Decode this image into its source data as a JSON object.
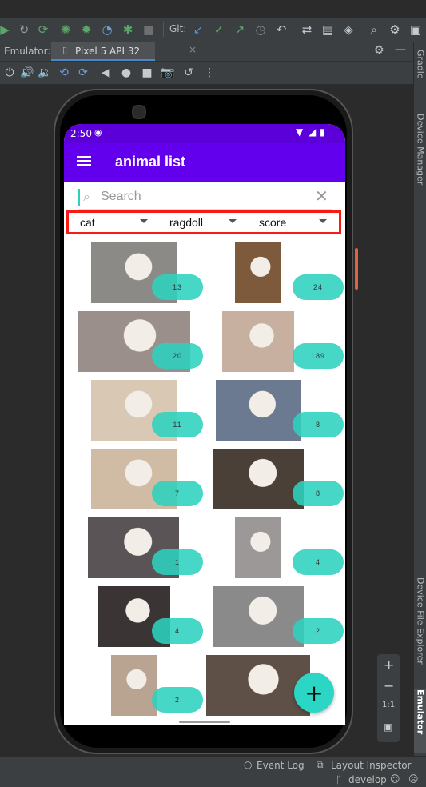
{
  "ide": {
    "git_label": "Git:",
    "tabs": {
      "emulator_label": "Emulator:",
      "device_tab": "Pixel 5 API 32",
      "close_glyph": "×"
    },
    "side_tools": {
      "gradle": "Gradle",
      "device_manager": "Device Manager",
      "device_file_explorer": "Device File Explorer",
      "emulator": "Emulator"
    },
    "zoom": {
      "plus": "+",
      "minus": "−",
      "ratio": "1:1"
    },
    "status": {
      "event_log": "Event Log",
      "layout_inspector": "Layout Inspector",
      "branch": "develop"
    }
  },
  "device": {
    "time": "2:50",
    "app_title": "animal list",
    "search_placeholder": "Search",
    "filters": {
      "animal": "cat",
      "breed": "ragdoll",
      "sort": "score"
    },
    "animals": [
      {
        "score": "13",
        "color": "#8c8a86"
      },
      {
        "score": "24",
        "color": "#7d5a3c"
      },
      {
        "score": "20",
        "color": "#9a8f8a"
      },
      {
        "score": "189",
        "color": "#c8b0a0"
      },
      {
        "score": "11",
        "color": "#d8c8b4"
      },
      {
        "score": "8",
        "color": "#6b7a90"
      },
      {
        "score": "7",
        "color": "#d0bca4"
      },
      {
        "score": "8",
        "color": "#4a4038"
      },
      {
        "score": "1",
        "color": "#5a5456"
      },
      {
        "score": "4",
        "color": "#9c9898"
      },
      {
        "score": "4",
        "color": "#3a3534"
      },
      {
        "score": "2",
        "color": "#8a8a8a"
      },
      {
        "score": "2",
        "color": "#b8a490"
      },
      {
        "score": "",
        "color": "#5e5046"
      }
    ],
    "fab_label": "+"
  },
  "colors": {
    "app_primary": "#6200ee",
    "status_bar": "#5c00d9",
    "pill": "#2cd1be",
    "highlight_border": "#f41c14"
  }
}
